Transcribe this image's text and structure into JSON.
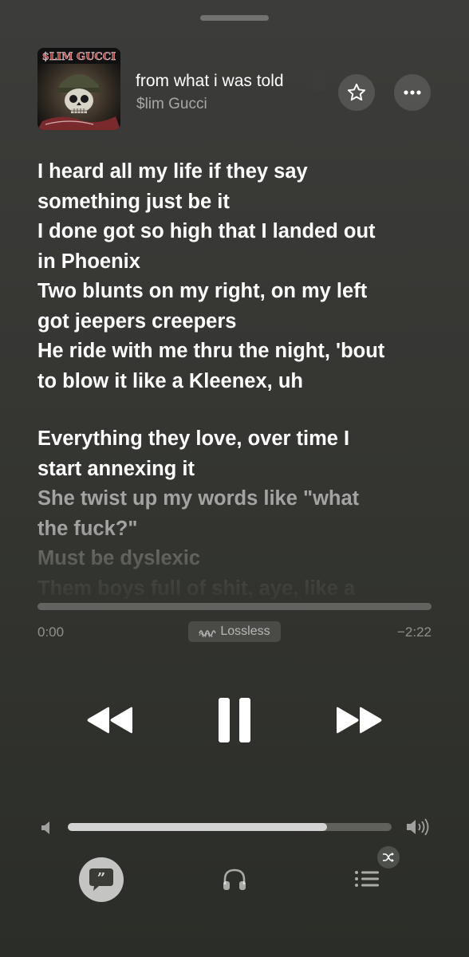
{
  "now_playing": {
    "title": "from what i was told",
    "artist": "$lim Gucci",
    "album_art": {
      "text": "$LIM GUCCI",
      "icon": "skull-soldier-artwork"
    }
  },
  "actions": {
    "favorite_icon": "star-icon",
    "more_icon": "ellipsis-icon"
  },
  "lyrics": {
    "lines": [
      "I heard all my life if they say",
      "something just be it",
      "I done got so high that I landed out",
      "in Phoenix",
      "Two blunts on my right, on my left",
      "got jeepers creepers",
      "He ride with me thru the night, 'bout",
      "to blow it like a Kleenex, uh",
      "Everything they love, over time I",
      "start annexing it",
      "She twist up my words like \"what",
      "the fuck?\"",
      "Must be dyslexic",
      "Them boys full of shit, aye, like a"
    ]
  },
  "playback": {
    "elapsed": "0:00",
    "remaining": "−2:22",
    "badge": "Lossless",
    "progress": 0.0
  },
  "controls": {
    "rewind_icon": "rewind-icon",
    "pause_icon": "pause-icon",
    "forward_icon": "fast-forward-icon"
  },
  "volume": {
    "level": 0.8
  },
  "bottom_bar": {
    "lyrics_icon": "lyrics-quote-icon",
    "airplay_icon": "airplay-headphones-icon",
    "queue_icon": "queue-list-icon",
    "shuffle_icon": "shuffle-icon"
  },
  "colors": {
    "background": "#383835",
    "text": "#ffffff"
  }
}
